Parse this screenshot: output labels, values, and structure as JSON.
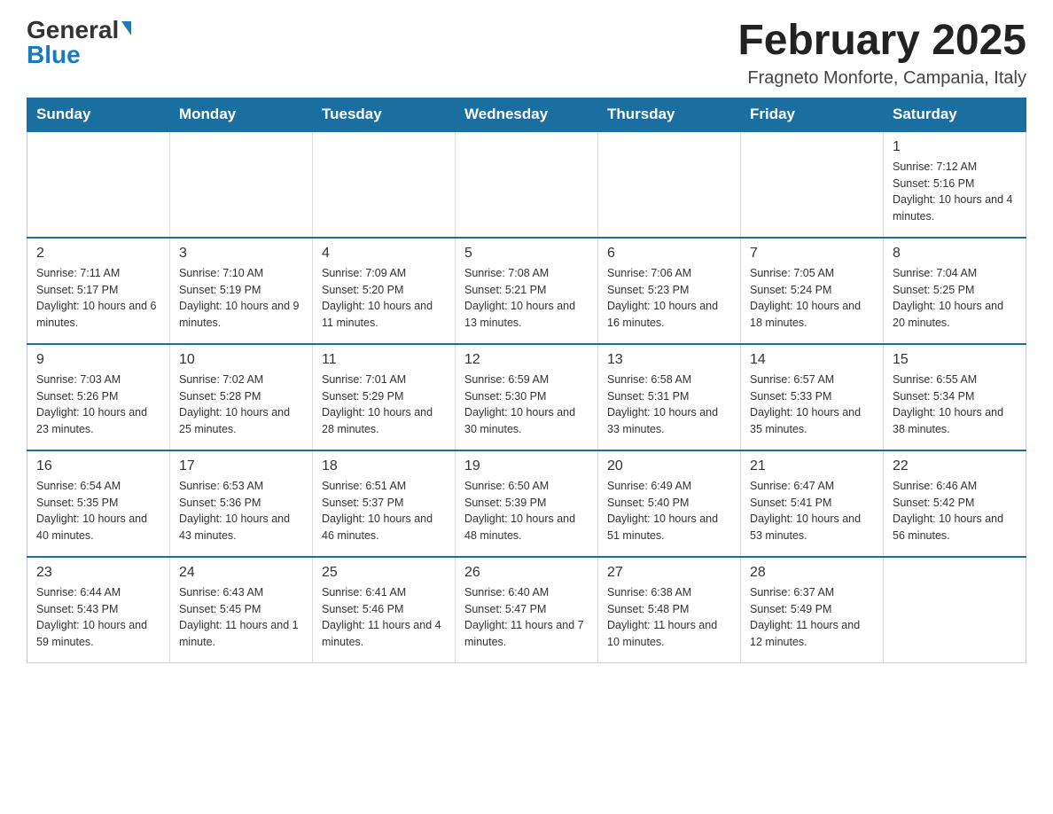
{
  "header": {
    "logo_general": "General",
    "logo_blue": "Blue",
    "title": "February 2025",
    "subtitle": "Fragneto Monforte, Campania, Italy"
  },
  "days_of_week": [
    "Sunday",
    "Monday",
    "Tuesday",
    "Wednesday",
    "Thursday",
    "Friday",
    "Saturday"
  ],
  "weeks": [
    [
      {
        "day": "",
        "info": ""
      },
      {
        "day": "",
        "info": ""
      },
      {
        "day": "",
        "info": ""
      },
      {
        "day": "",
        "info": ""
      },
      {
        "day": "",
        "info": ""
      },
      {
        "day": "",
        "info": ""
      },
      {
        "day": "1",
        "info": "Sunrise: 7:12 AM\nSunset: 5:16 PM\nDaylight: 10 hours and 4 minutes."
      }
    ],
    [
      {
        "day": "2",
        "info": "Sunrise: 7:11 AM\nSunset: 5:17 PM\nDaylight: 10 hours and 6 minutes."
      },
      {
        "day": "3",
        "info": "Sunrise: 7:10 AM\nSunset: 5:19 PM\nDaylight: 10 hours and 9 minutes."
      },
      {
        "day": "4",
        "info": "Sunrise: 7:09 AM\nSunset: 5:20 PM\nDaylight: 10 hours and 11 minutes."
      },
      {
        "day": "5",
        "info": "Sunrise: 7:08 AM\nSunset: 5:21 PM\nDaylight: 10 hours and 13 minutes."
      },
      {
        "day": "6",
        "info": "Sunrise: 7:06 AM\nSunset: 5:23 PM\nDaylight: 10 hours and 16 minutes."
      },
      {
        "day": "7",
        "info": "Sunrise: 7:05 AM\nSunset: 5:24 PM\nDaylight: 10 hours and 18 minutes."
      },
      {
        "day": "8",
        "info": "Sunrise: 7:04 AM\nSunset: 5:25 PM\nDaylight: 10 hours and 20 minutes."
      }
    ],
    [
      {
        "day": "9",
        "info": "Sunrise: 7:03 AM\nSunset: 5:26 PM\nDaylight: 10 hours and 23 minutes."
      },
      {
        "day": "10",
        "info": "Sunrise: 7:02 AM\nSunset: 5:28 PM\nDaylight: 10 hours and 25 minutes."
      },
      {
        "day": "11",
        "info": "Sunrise: 7:01 AM\nSunset: 5:29 PM\nDaylight: 10 hours and 28 minutes."
      },
      {
        "day": "12",
        "info": "Sunrise: 6:59 AM\nSunset: 5:30 PM\nDaylight: 10 hours and 30 minutes."
      },
      {
        "day": "13",
        "info": "Sunrise: 6:58 AM\nSunset: 5:31 PM\nDaylight: 10 hours and 33 minutes."
      },
      {
        "day": "14",
        "info": "Sunrise: 6:57 AM\nSunset: 5:33 PM\nDaylight: 10 hours and 35 minutes."
      },
      {
        "day": "15",
        "info": "Sunrise: 6:55 AM\nSunset: 5:34 PM\nDaylight: 10 hours and 38 minutes."
      }
    ],
    [
      {
        "day": "16",
        "info": "Sunrise: 6:54 AM\nSunset: 5:35 PM\nDaylight: 10 hours and 40 minutes."
      },
      {
        "day": "17",
        "info": "Sunrise: 6:53 AM\nSunset: 5:36 PM\nDaylight: 10 hours and 43 minutes."
      },
      {
        "day": "18",
        "info": "Sunrise: 6:51 AM\nSunset: 5:37 PM\nDaylight: 10 hours and 46 minutes."
      },
      {
        "day": "19",
        "info": "Sunrise: 6:50 AM\nSunset: 5:39 PM\nDaylight: 10 hours and 48 minutes."
      },
      {
        "day": "20",
        "info": "Sunrise: 6:49 AM\nSunset: 5:40 PM\nDaylight: 10 hours and 51 minutes."
      },
      {
        "day": "21",
        "info": "Sunrise: 6:47 AM\nSunset: 5:41 PM\nDaylight: 10 hours and 53 minutes."
      },
      {
        "day": "22",
        "info": "Sunrise: 6:46 AM\nSunset: 5:42 PM\nDaylight: 10 hours and 56 minutes."
      }
    ],
    [
      {
        "day": "23",
        "info": "Sunrise: 6:44 AM\nSunset: 5:43 PM\nDaylight: 10 hours and 59 minutes."
      },
      {
        "day": "24",
        "info": "Sunrise: 6:43 AM\nSunset: 5:45 PM\nDaylight: 11 hours and 1 minute."
      },
      {
        "day": "25",
        "info": "Sunrise: 6:41 AM\nSunset: 5:46 PM\nDaylight: 11 hours and 4 minutes."
      },
      {
        "day": "26",
        "info": "Sunrise: 6:40 AM\nSunset: 5:47 PM\nDaylight: 11 hours and 7 minutes."
      },
      {
        "day": "27",
        "info": "Sunrise: 6:38 AM\nSunset: 5:48 PM\nDaylight: 11 hours and 10 minutes."
      },
      {
        "day": "28",
        "info": "Sunrise: 6:37 AM\nSunset: 5:49 PM\nDaylight: 11 hours and 12 minutes."
      },
      {
        "day": "",
        "info": ""
      }
    ]
  ]
}
